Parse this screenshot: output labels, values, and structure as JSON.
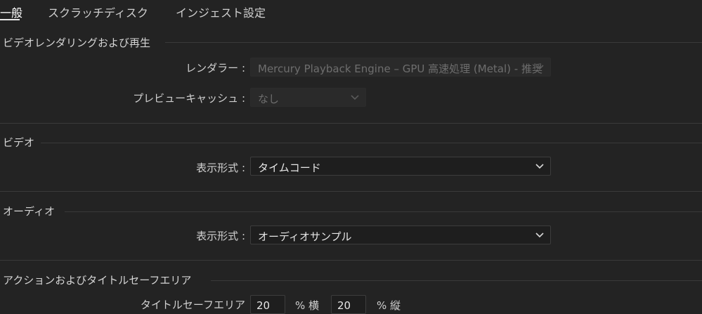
{
  "tabs": [
    {
      "label": "一般",
      "active": true
    },
    {
      "label": "スクラッチディスク",
      "active": false
    },
    {
      "label": "インジェスト設定",
      "active": false
    }
  ],
  "sections": {
    "playback": {
      "title": "ビデオレンダリングおよび再生",
      "renderer_label": "レンダラー :",
      "renderer_value": "Mercury Playback Engine – GPU 高速処理 (Metal) - 推奨",
      "preview_cache_label": "プレビューキャッシュ :",
      "preview_cache_value": "なし"
    },
    "video": {
      "title": "ビデオ",
      "format_label": "表示形式 :",
      "format_value": "タイムコード"
    },
    "audio": {
      "title": "オーディオ",
      "format_label": "表示形式 :",
      "format_value": "オーディオサンプル"
    },
    "safe_area": {
      "title": "アクションおよびタイトルセーフエリア",
      "title_safe_label": "タイトルセーフエリア",
      "horizontal_value": "20",
      "horizontal_unit": "% 横",
      "vertical_value": "20",
      "vertical_unit": "% 縦"
    }
  },
  "colors": {
    "background": "#232323",
    "field": "#1e1e1e",
    "divider": "#3a3a3a"
  }
}
